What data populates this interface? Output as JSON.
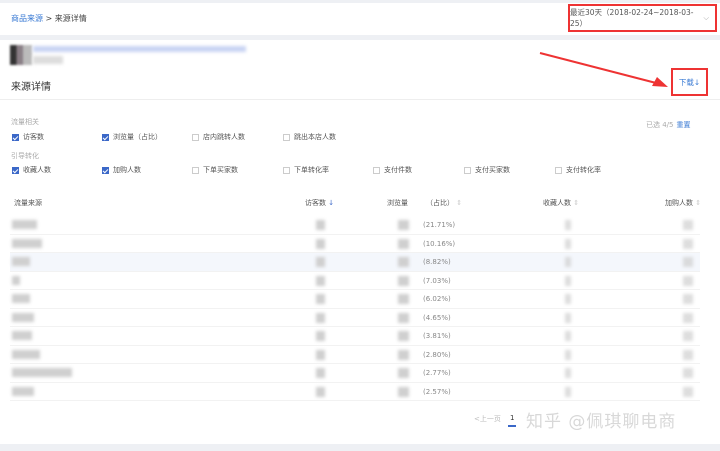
{
  "breadcrumb": {
    "parent": "商品来源",
    "separator": ">",
    "current": "来源详情"
  },
  "date_range": {
    "label": "最近30天（2018-02-24~2018-03-25）",
    "icon": "chevron-down-icon"
  },
  "section_title": "来源详情",
  "download_label": "下载↓",
  "metrics": {
    "selected_text": "已选 4/5",
    "reset_label": "重置",
    "groups": [
      {
        "label": "流量相关",
        "items": [
          {
            "label": "访客数",
            "checked": true
          },
          {
            "label": "浏览量（占比）",
            "checked": true
          },
          {
            "label": "店内跳转人数",
            "checked": false
          },
          {
            "label": "跳出本店人数",
            "checked": false
          }
        ]
      },
      {
        "label": "引导转化",
        "items": [
          {
            "label": "收藏人数",
            "checked": true
          },
          {
            "label": "加购人数",
            "checked": true
          },
          {
            "label": "下单买家数",
            "checked": false
          },
          {
            "label": "下单转化率",
            "checked": false
          },
          {
            "label": "支付件数",
            "checked": false
          },
          {
            "label": "支付买家数",
            "checked": false
          },
          {
            "label": "支付转化率",
            "checked": false
          }
        ]
      }
    ]
  },
  "table": {
    "headers": [
      "流量来源",
      "访客数",
      "浏览量",
      "（占比）",
      "收藏人数",
      "加购人数"
    ],
    "rows": [
      {
        "share": "(21.71%)"
      },
      {
        "share": "(10.16%)"
      },
      {
        "share": "(8.82%)"
      },
      {
        "share": "(7.03%)"
      },
      {
        "share": "(6.02%)"
      },
      {
        "share": "(4.65%)"
      },
      {
        "share": "(3.81%)"
      },
      {
        "share": "(2.80%)"
      },
      {
        "share": "(2.77%)"
      },
      {
        "share": "(2.57%)"
      }
    ]
  },
  "pagination": {
    "prev": "<上一页",
    "current": "1"
  },
  "watermark": "知乎 @佩琪聊电商",
  "colors": {
    "accent": "#3b7bd4",
    "annotation": "#e33333"
  }
}
